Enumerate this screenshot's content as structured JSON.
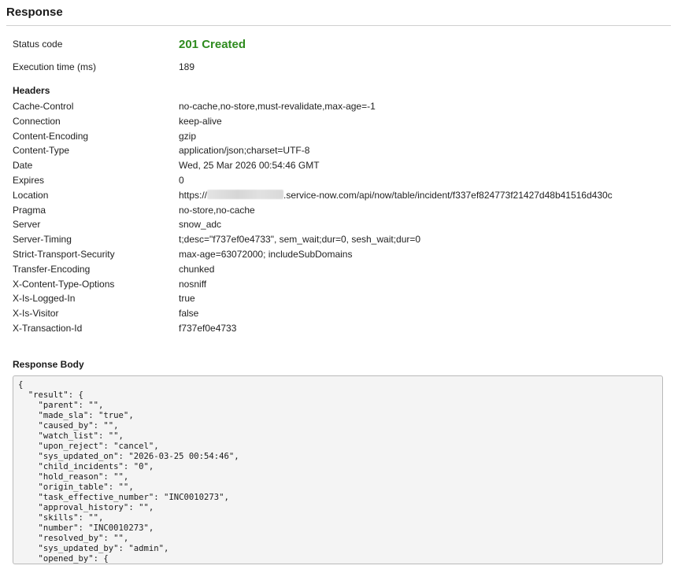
{
  "response": {
    "title": "Response",
    "status_label": "Status code",
    "status_value": "201 Created",
    "status_color": "#2e8b1e",
    "exec_label": "Execution time (ms)",
    "exec_value": "189",
    "headers_title": "Headers",
    "headers": [
      {
        "name": "Cache-Control",
        "value": "no-cache,no-store,must-revalidate,max-age=-1"
      },
      {
        "name": "Connection",
        "value": "keep-alive"
      },
      {
        "name": "Content-Encoding",
        "value": "gzip"
      },
      {
        "name": "Content-Type",
        "value": "application/json;charset=UTF-8"
      },
      {
        "name": "Date",
        "value": "Wed, 25 Mar 2026 00:54:46 GMT"
      },
      {
        "name": "Expires",
        "value": "0"
      },
      {
        "name": "Location",
        "value_prefix": "https://",
        "value_suffix": ".service-now.com/api/now/table/incident/f337ef824773f21427d48b41516d430c"
      },
      {
        "name": "Pragma",
        "value": "no-store,no-cache"
      },
      {
        "name": "Server",
        "value": "snow_adc"
      },
      {
        "name": "Server-Timing",
        "value": "t;desc=\"f737ef0e4733\", sem_wait;dur=0, sesh_wait;dur=0"
      },
      {
        "name": "Strict-Transport-Security",
        "value": "max-age=63072000; includeSubDomains"
      },
      {
        "name": "Transfer-Encoding",
        "value": "chunked"
      },
      {
        "name": "X-Content-Type-Options",
        "value": "nosniff"
      },
      {
        "name": "X-Is-Logged-In",
        "value": "true"
      },
      {
        "name": "X-Is-Visitor",
        "value": "false"
      },
      {
        "name": "X-Transaction-Id",
        "value": "f737ef0e4733"
      }
    ],
    "body_title": "Response Body",
    "body_text": "{\n  \"result\": {\n    \"parent\": \"\",\n    \"made_sla\": \"true\",\n    \"caused_by\": \"\",\n    \"watch_list\": \"\",\n    \"upon_reject\": \"cancel\",\n    \"sys_updated_on\": \"2026-03-25 00:54:46\",\n    \"child_incidents\": \"0\",\n    \"hold_reason\": \"\",\n    \"origin_table\": \"\",\n    \"task_effective_number\": \"INC0010273\",\n    \"approval_history\": \"\",\n    \"skills\": \"\",\n    \"number\": \"INC0010273\",\n    \"resolved_by\": \"\",\n    \"sys_updated_by\": \"admin\",\n    \"opened_by\": {"
  }
}
